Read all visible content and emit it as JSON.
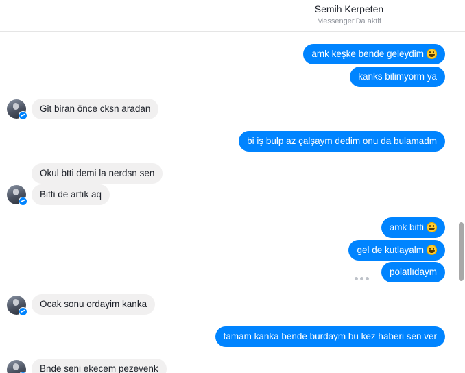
{
  "header": {
    "contact_name": "Semih Kerpeten",
    "status": "Messenger'Da aktif"
  },
  "messages": [
    {
      "side": "out",
      "text": "amk keşke bende geleydim",
      "emoji": "grinning-face"
    },
    {
      "side": "out",
      "text": "kanks bilimyorm ya"
    },
    {
      "side": "in",
      "text": "Git biran önce cksn aradan"
    },
    {
      "side": "out",
      "text": "bi iş bulp az çalşaym dedim onu da bulamadm"
    },
    {
      "side": "in",
      "text": "Okul btti demi la nerdsn sen"
    },
    {
      "side": "in",
      "text": "Bitti de artık aq"
    },
    {
      "side": "out",
      "text": "amk bitti",
      "emoji": "grinning-face"
    },
    {
      "side": "out",
      "text": "gel de kutlayalm",
      "emoji": "grinning-face"
    },
    {
      "side": "out",
      "text": "polatlıdaym"
    },
    {
      "side": "in",
      "text": "Ocak sonu ordayim kanka"
    },
    {
      "side": "out",
      "text": "tamam kanka bende burdaym bu kez haberi sen ver"
    },
    {
      "side": "in",
      "text": "Bnde seni ekecem pezevenk"
    }
  ],
  "colors": {
    "outgoing_bubble": "#0084ff",
    "incoming_bubble": "#f1f0f0",
    "messenger_badge": "#0084ff"
  },
  "icons": {
    "emoji": "grinning-face-icon",
    "avatar_badge": "messenger-icon",
    "more_options": "more-dots-icon"
  }
}
